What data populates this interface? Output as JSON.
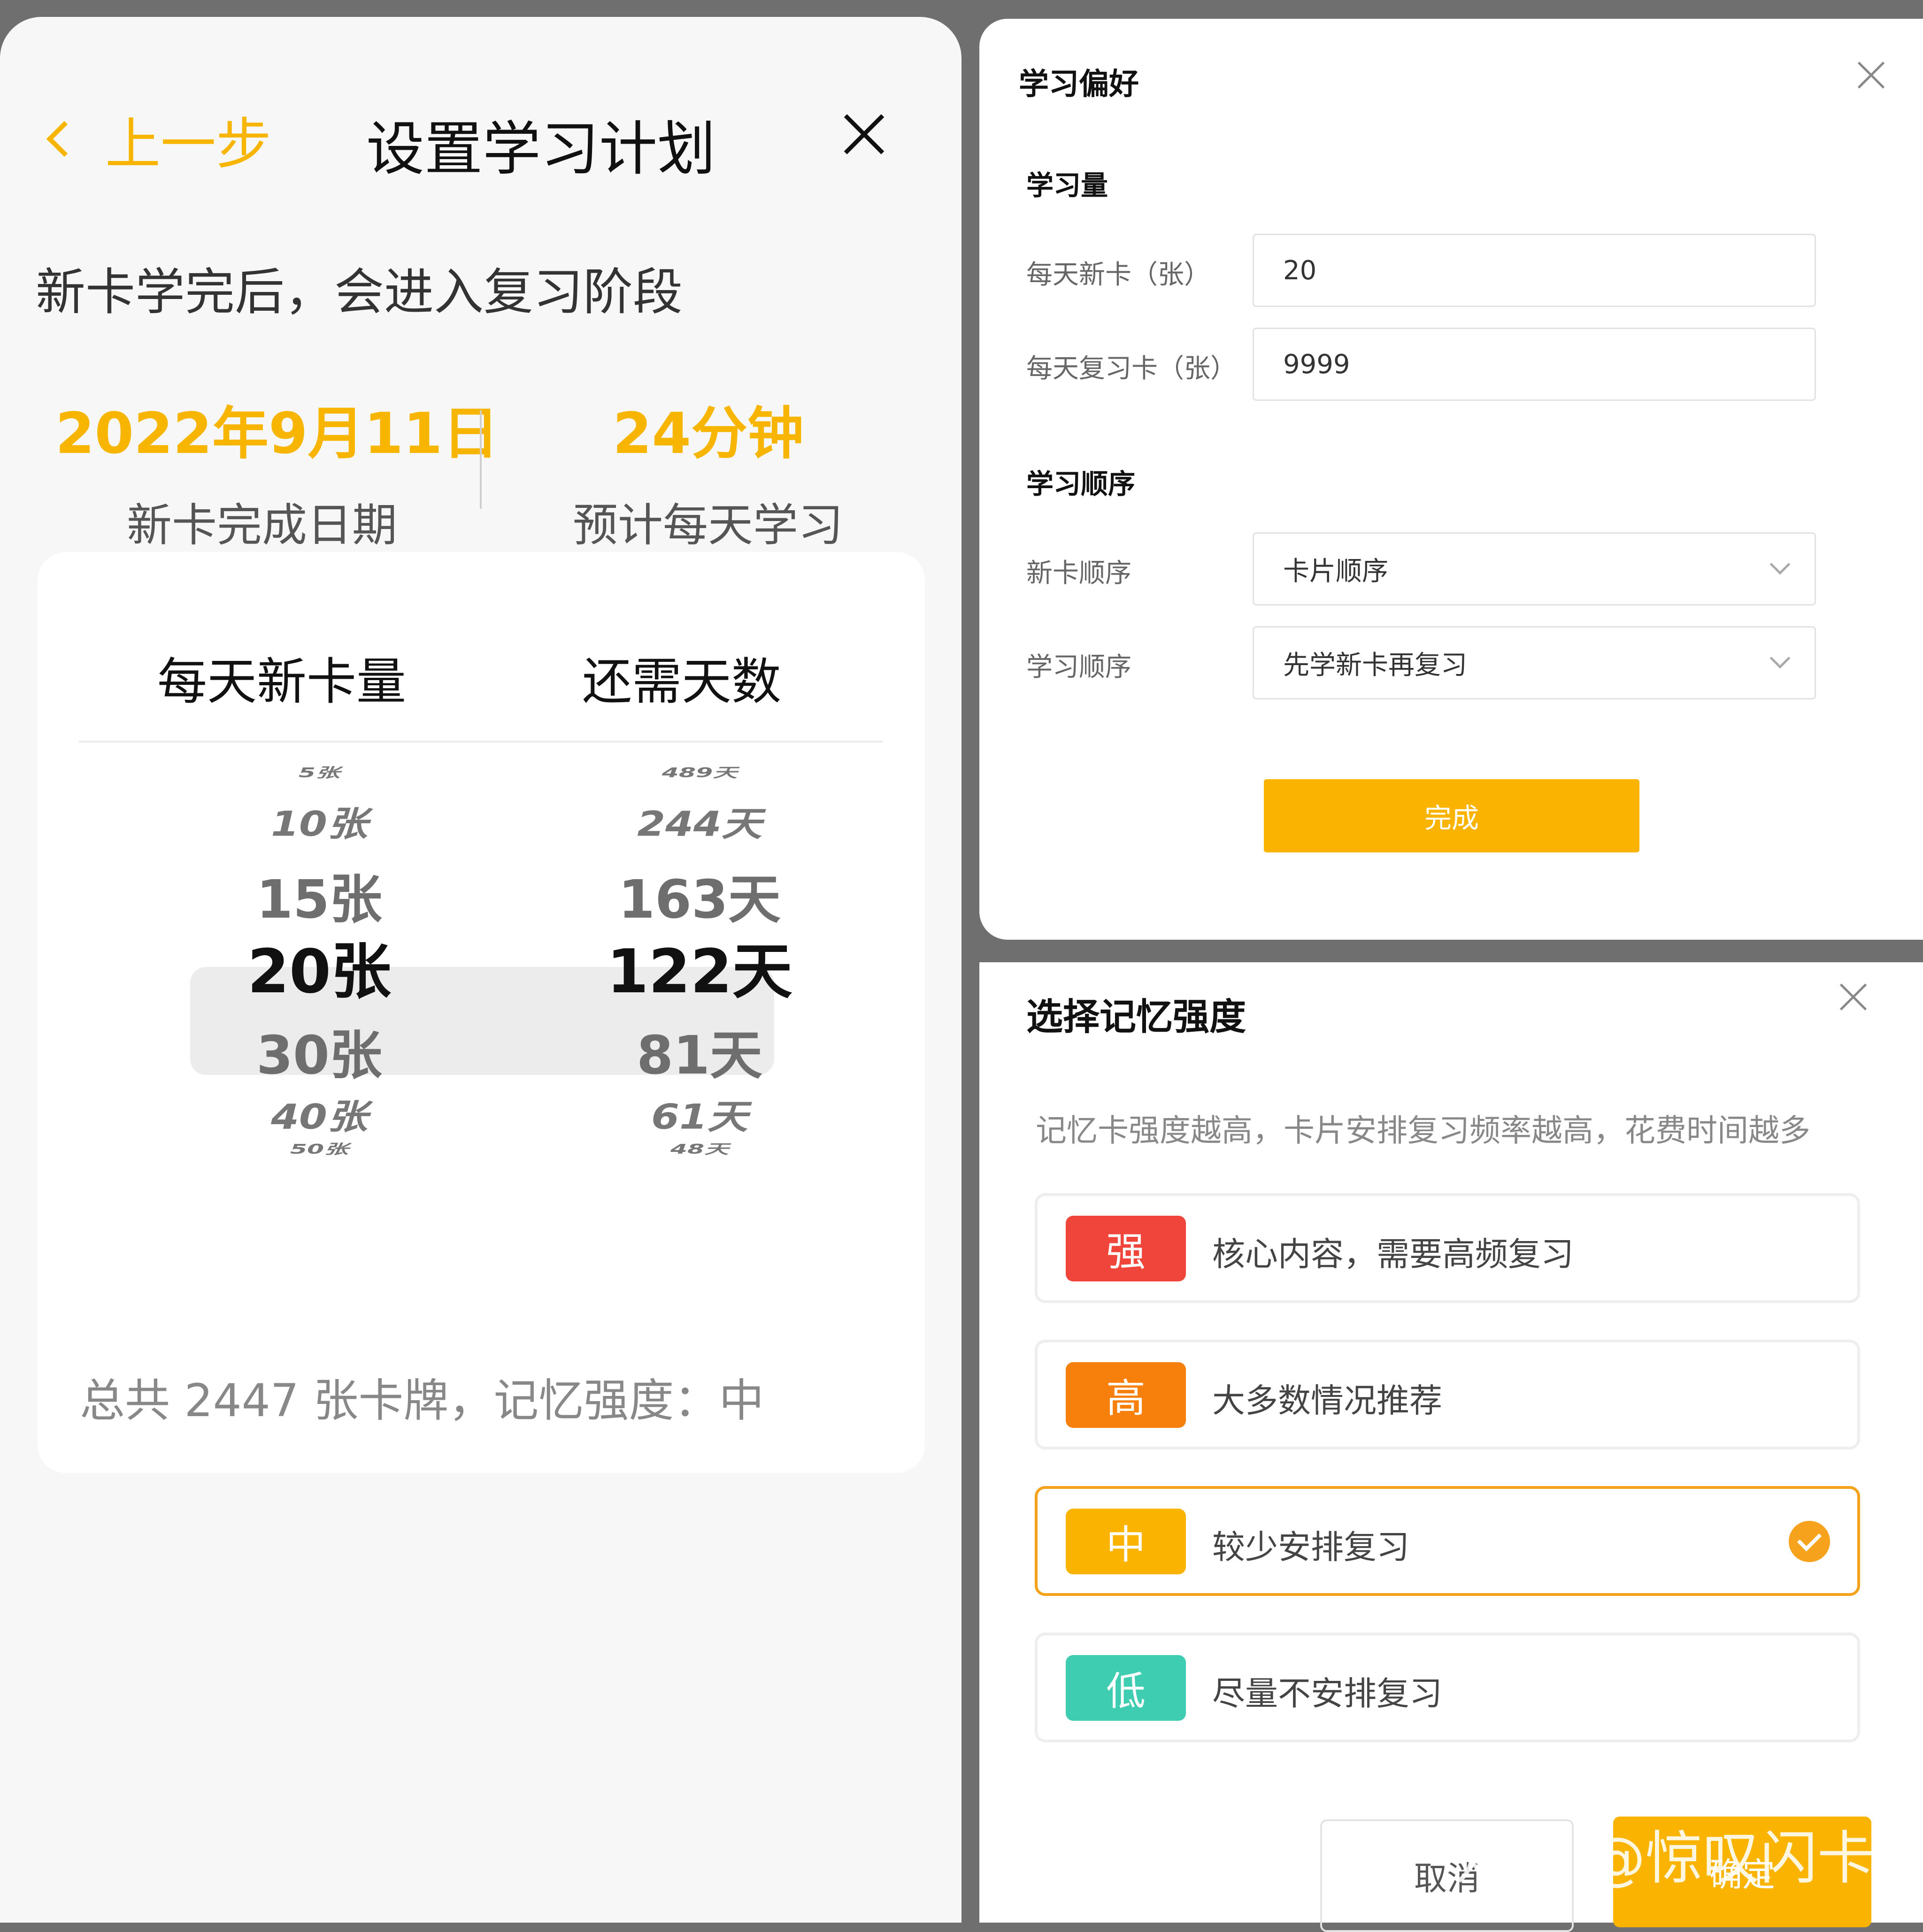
{
  "left": {
    "back_label": "上一步",
    "title": "设置学习计划",
    "subtitle": "新卡学完后，会进入复习阶段",
    "completion_date": "2022年9月11日",
    "completion_date_label": "新卡完成日期",
    "daily_time": "24分钟",
    "daily_time_label": "预计每天学习",
    "picker": {
      "col1_header": "每天新卡量",
      "col2_header": "还需天数",
      "col1_items": [
        "5张",
        "10张",
        "15张",
        "20张",
        "30张",
        "40张",
        "50张"
      ],
      "col2_items": [
        "489天",
        "244天",
        "163天",
        "122天",
        "81天",
        "61天",
        "48天"
      ],
      "selected_index": 3
    },
    "footer": "总共 2447 张卡牌，记忆强度：中"
  },
  "prefs_dialog": {
    "title": "学习偏好",
    "amount_section": "学习量",
    "new_cards_label": "每天新卡（张）",
    "new_cards_value": "20",
    "review_cards_label": "每天复习卡（张）",
    "review_cards_value": "9999",
    "order_section": "学习顺序",
    "new_order_label": "新卡顺序",
    "new_order_value": "卡片顺序",
    "study_order_label": "学习顺序",
    "study_order_value": "先学新卡再复习",
    "done_label": "完成"
  },
  "strength_dialog": {
    "title": "选择记忆强度",
    "description": "记忆卡强度越高，卡片安排复习频率越高，花费时间越多",
    "options": [
      {
        "badge": "强",
        "text": "核心内容，需要高频复习",
        "color": "#f0453a"
      },
      {
        "badge": "高",
        "text": "大多数情况推荐",
        "color": "#f77f0b"
      },
      {
        "badge": "中",
        "text": "较少安排复习",
        "color": "#f9b300"
      },
      {
        "badge": "低",
        "text": "尽量不安排复习",
        "color": "#3fcdb1"
      }
    ],
    "selected_index": 2,
    "cancel_label": "取消",
    "confirm_label": "确定"
  },
  "watermark": "知乎 @惊叹闪卡",
  "colors": {
    "accent": "#f7b500",
    "button": "#fab400",
    "selected_border": "#f5a21b"
  }
}
